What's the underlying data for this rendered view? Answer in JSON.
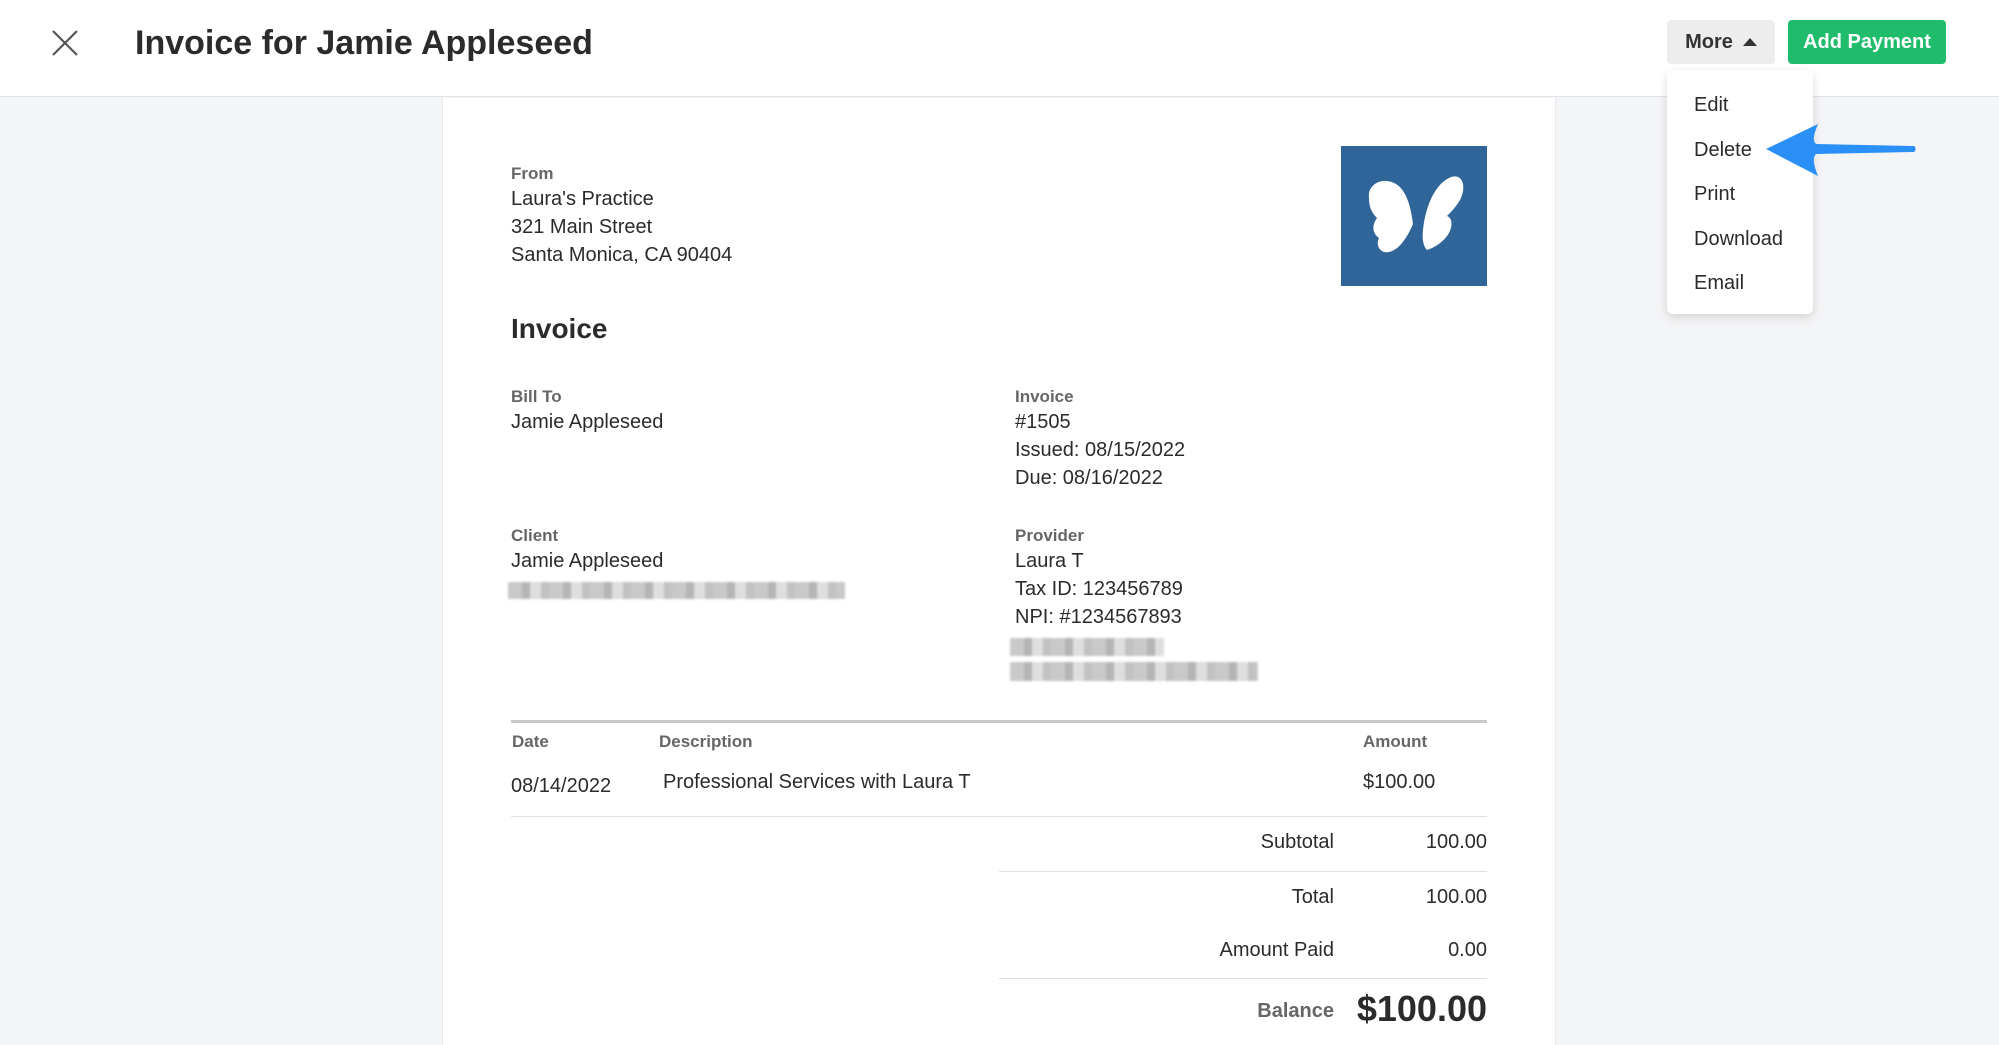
{
  "header": {
    "title": "Invoice for Jamie Appleseed",
    "more_label": "More",
    "add_payment_label": "Add Payment",
    "close_icon": "close-icon"
  },
  "more_menu": {
    "items": [
      "Edit",
      "Delete",
      "Print",
      "Download",
      "Email"
    ],
    "highlighted": "Delete"
  },
  "colors": {
    "add_payment_bg": "#1fbd6b",
    "logo_bg": "#2f6598",
    "arrow": "#2a8ff7"
  },
  "invoice": {
    "from_label": "From",
    "from_name": "Laura's Practice",
    "from_street": "321 Main Street",
    "from_city": "Santa Monica, CA 90404",
    "heading": "Invoice",
    "bill_to_label": "Bill To",
    "bill_to_name": "Jamie Appleseed",
    "invoice_label": "Invoice",
    "invoice_number": "#1505",
    "issued": "Issued: 08/15/2022",
    "due": "Due: 08/16/2022",
    "client_label": "Client",
    "client_name": "Jamie Appleseed",
    "provider_label": "Provider",
    "provider_name": "Laura T",
    "provider_tax_id": "Tax ID: 123456789",
    "provider_npi": "NPI: #1234567893"
  },
  "table": {
    "headers": {
      "date": "Date",
      "description": "Description",
      "amount": "Amount"
    },
    "rows": [
      {
        "date": "08/14/2022",
        "description": "Professional Services with Laura T",
        "amount": "$100.00"
      }
    ]
  },
  "totals": {
    "subtotal_label": "Subtotal",
    "subtotal": "100.00",
    "total_label": "Total",
    "total": "100.00",
    "paid_label": "Amount Paid",
    "paid": "0.00",
    "balance_label": "Balance",
    "balance": "$100.00"
  }
}
